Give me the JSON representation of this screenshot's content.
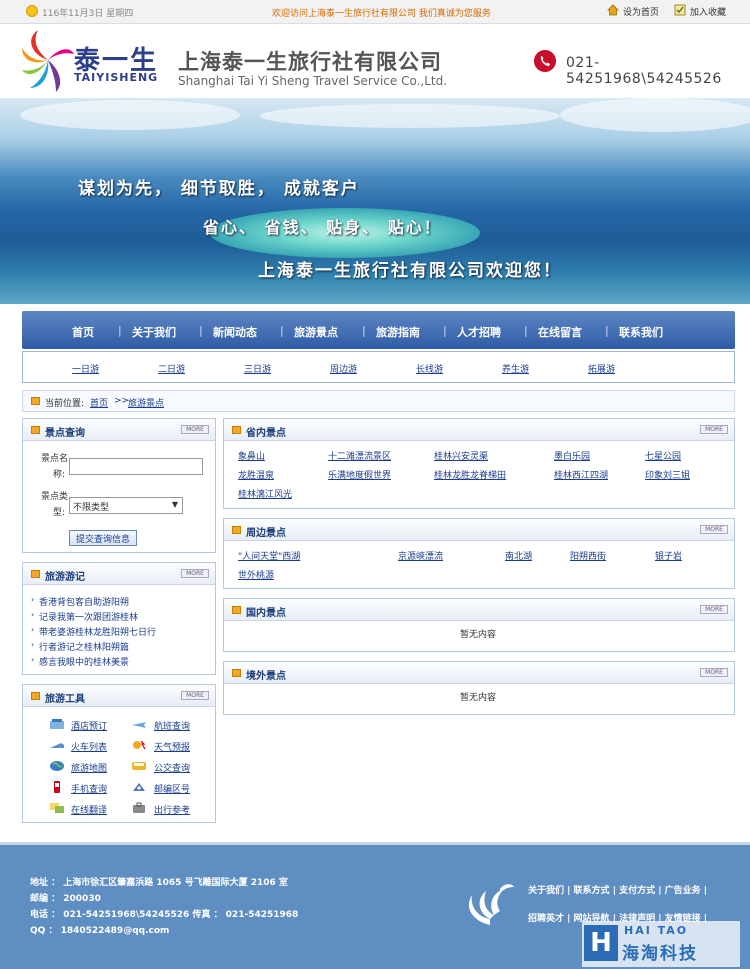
{
  "topbar": {
    "date": "116年11月3日 星期四",
    "welcome": "欢迎访问上海泰一生旅行社有限公司  我们真诚为您服务",
    "set_home": "设为首页",
    "bookmark": "加入收藏"
  },
  "header": {
    "brand_cn": "泰一生",
    "brand_en": "TAIYISHENG",
    "company_cn": "上海泰一生旅行社有限公司",
    "company_en": "Shanghai Tai Yi Sheng Travel Service Co.,Ltd.",
    "phone": "021-54251968\\54245526"
  },
  "banner": {
    "slogan1": "谋划为先，  细节取胜，  成就客户",
    "slogan2": "省心、  省钱、  贴身、  贴心！",
    "slogan3": "上海泰一生旅行社有限公司欢迎您！"
  },
  "nav": [
    "首页",
    "关于我们",
    "新闻动态",
    "旅游景点",
    "旅游指南",
    "人才招聘",
    "在线留言",
    "联系我们"
  ],
  "subnav": [
    "一日游",
    "二日游",
    "三日游",
    "周边游",
    "长线游",
    "养生游",
    "拓展游"
  ],
  "breadcrumb": {
    "prefix": "当前位置:",
    "home": "首页",
    "sep": ">>",
    "current": "旅游景点"
  },
  "search": {
    "title": "景点查询",
    "name_label_1": "景点名",
    "name_label_2": "称:",
    "type_label_1": "景点类",
    "type_label_2": "型:",
    "type_value": "不限类型",
    "submit": "提交查询信息"
  },
  "notes": {
    "title": "旅游游记",
    "items": [
      "香港背包客自助游阳朔",
      "记录我第一次跟团游桂林",
      "带老婆游桂林龙胜阳朔七日行",
      "行者游记之桂林阳朔篇",
      "感言我眼中的桂林美景"
    ]
  },
  "tools": {
    "title": "旅游工具",
    "items": [
      "酒店预订",
      "航班查询",
      "火车列表",
      "天气预报",
      "旅游地图",
      "公交查询",
      "手机查询",
      "邮编区号",
      "在线翻译",
      "出行参考"
    ]
  },
  "province": {
    "title": "省内景点",
    "items": [
      "象鼻山",
      "十二滩漂流景区",
      "桂林兴安灵渠",
      "墨白乐园",
      "七星公园",
      "龙胜温泉",
      "乐满地度假世界",
      "桂林龙胜龙脊梯田",
      "桂林西江四湖",
      "印象刘三姐",
      "桂林漓江风光"
    ]
  },
  "nearby": {
    "title": "周边景点",
    "items": [
      "\"人间天堂\"西湖",
      "京源峡漂流",
      "南北湖",
      "阳朔西街",
      "银子岩",
      "世外桃源"
    ]
  },
  "domestic": {
    "title": "国内景点",
    "empty": "暂无内容"
  },
  "abroad": {
    "title": "境外景点",
    "empty": "暂无内容"
  },
  "more_label": "MORE",
  "footer": {
    "address": "地址 ： 上海市徐汇区肇嘉浜路 1065 号飞雕国际大厦 2106 室",
    "zip": "邮编 ： 200030",
    "tel": "电话 ： 021-54251968\\54245526 传真 ： 021-54251968",
    "qq": "QQ ：  1840522489@qq.com",
    "links1": "关于我们 | 联系方式 | 支付方式 | 广告业务 |",
    "links2": "招聘英才 | 网站导航 | 法律声明 | 友情链接 |"
  },
  "watermark": {
    "top": "HAI TAO",
    "cn": "海淘科技",
    "letter": "H"
  },
  "colors": {
    "nav": "#2f5ca6",
    "footer": "#5f8ec3",
    "accent": "#f2a72a"
  }
}
